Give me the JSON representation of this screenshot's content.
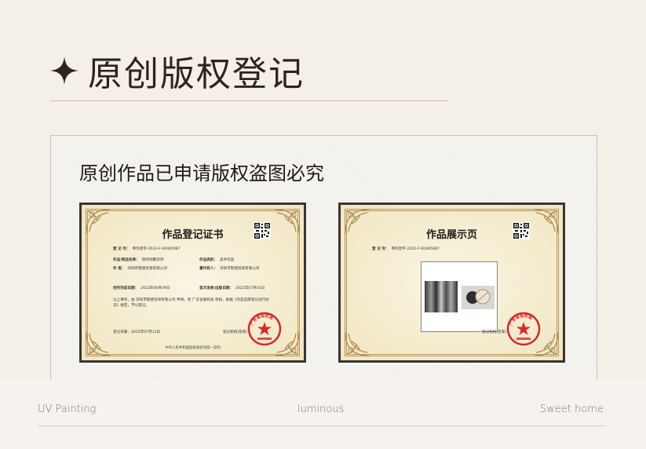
{
  "header": {
    "title": "原创版权登记",
    "icon": "star-icon"
  },
  "panel": {
    "heading": "原创作品已申请版权盗图必究"
  },
  "certificates": [
    {
      "title": "作品登记证书",
      "reg_no_label": "登 记 号：",
      "reg_no": "粤作登字-2022-F-00485087",
      "fields": [
        {
          "label": "作品/制品名称：",
          "value": "悠然闲聚装饰"
        },
        {
          "label": "作品类别：",
          "value": "美术作品"
        },
        {
          "label": "作      者：",
          "value": "深圳市琨德贸易有限公司"
        },
        {
          "label": "著作权人：",
          "value": "深圳市琨德贸易有限公司"
        },
        {
          "label": "创作完成日期：",
          "value": "2022年06月09日"
        },
        {
          "label": "首次发表/出版日期：",
          "value": "2022年07月01日"
        }
      ],
      "body_text": "以上事项，由 深圳市琨德贸易有限公司 申请，经 广东省版权局 审核，根据《作品自愿登记试行办法》规定，予以登记。",
      "date_left": "登记日期：2022年07月11日",
      "org_right": "登记机构(签章)",
      "footer": "中华人民共和国国家版权局统一监制",
      "seal_text": "广东省版权局"
    },
    {
      "title": "作品展示页",
      "reg_no_label": "登 记 号：",
      "reg_no": "粤作登字-2022-F-00485087",
      "org_right": "登记机构(签章)",
      "seal_text": "广东省版权局"
    }
  ],
  "footer": {
    "left": "UV Painting",
    "center": "luminous",
    "right": "Sweet home"
  },
  "colors": {
    "background": "#f4f0e7",
    "cert_frame": "#3a3532",
    "cert_paper": "#f7f1da",
    "seal_red": "#d8282a"
  }
}
